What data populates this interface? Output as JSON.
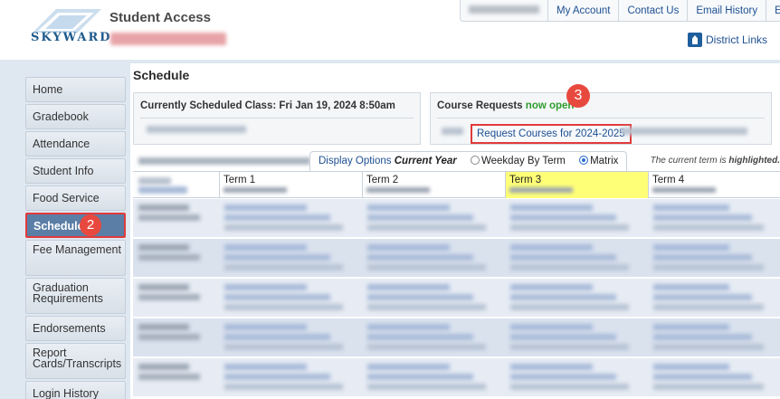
{
  "header": {
    "app_title": "Student Access",
    "logo_text": "SKYWARD",
    "links": [
      "My Account",
      "Contact Us",
      "Email History",
      "Exit"
    ],
    "district_links": "District Links"
  },
  "sidebar": {
    "items": [
      {
        "label": "Home"
      },
      {
        "label": "Gradebook"
      },
      {
        "label": "Attendance"
      },
      {
        "label": "Student Info"
      },
      {
        "label": "Food Service"
      },
      {
        "label": "Schedule",
        "active": true,
        "badge": "2"
      },
      {
        "label": "Fee Management"
      },
      {
        "label": "Graduation Requirements"
      },
      {
        "label": "Endorsements"
      },
      {
        "label": "Report Cards/Transcripts"
      },
      {
        "label": "Login History"
      }
    ]
  },
  "main": {
    "page_title": "Schedule",
    "current_class": "Currently Scheduled Class: Fri Jan 19, 2024 8:50am",
    "course_requests": {
      "label": "Course Requests",
      "status": "now open",
      "link": "Request Courses for 2024-2025",
      "badge": "3"
    },
    "display_options": {
      "label": "Display Options",
      "current": "Current Year",
      "opt1": "Weekday By Term",
      "opt2": "Matrix",
      "selected": "Matrix"
    },
    "note_prefix": "The current term is ",
    "note_bold": "highlighted.",
    "terms": [
      "Term 1",
      "Term 2",
      "Term 3",
      "Term 4"
    ],
    "current_term": "Term 3",
    "row_count": 5
  },
  "colors": {
    "accent": "#1d4f91",
    "highlight": "#ffff77",
    "annotation": "#e23b3b"
  }
}
